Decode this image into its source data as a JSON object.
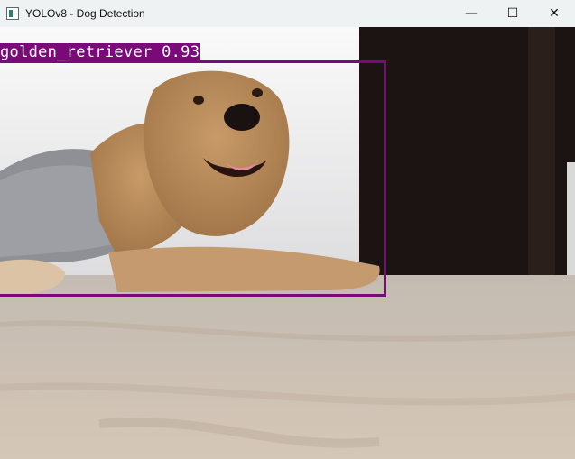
{
  "window": {
    "title": "YOLOv8 - Dog Detection",
    "controls": {
      "minimize": "—",
      "maximize": "☐",
      "close": "✕"
    }
  },
  "detection": {
    "label": "golden_retriever 0.93",
    "class_name": "golden_retriever",
    "confidence": 0.93,
    "box_color": "#7a0a7a"
  },
  "icons": {
    "app": "window-app-icon"
  }
}
